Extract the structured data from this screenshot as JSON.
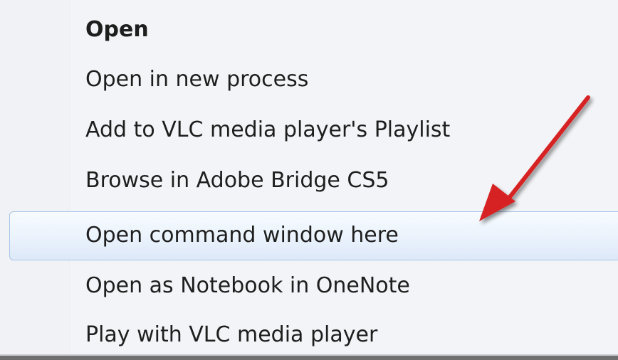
{
  "context_menu": {
    "items": [
      {
        "label": "Open",
        "default": true
      },
      {
        "label": "Open in new process"
      },
      {
        "label": "Add to VLC media player's Playlist"
      },
      {
        "label": "Browse in Adobe Bridge CS5"
      },
      {
        "label": "Open command window here",
        "highlighted": true
      },
      {
        "label": "Open as Notebook in OneNote"
      },
      {
        "label": "Play with VLC media player"
      }
    ]
  },
  "annotation": {
    "arrow_color": "#d62424",
    "points_to": "Open command window here"
  },
  "colors": {
    "menu_background": "#f3f4f7",
    "highlight_border": "#aac6e6",
    "highlight_fill": "#e6effb",
    "text": "#1e1e1e"
  }
}
